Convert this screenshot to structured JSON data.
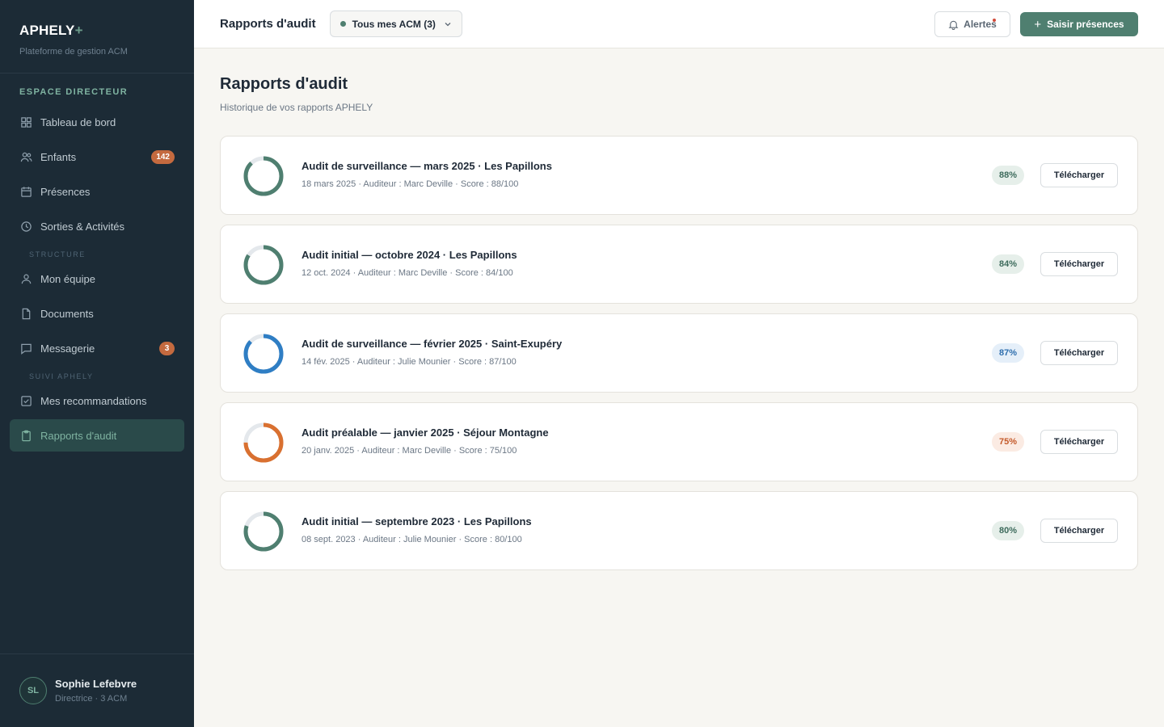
{
  "brand": {
    "name": "APHELY",
    "plus": "+",
    "subtitle": "Plateforme de gestion ACM"
  },
  "sidebar": {
    "section_main": "ESPACE DIRECTEUR",
    "items_main": [
      {
        "label": "Tableau de bord",
        "icon": "dashboard-icon"
      },
      {
        "label": "Enfants",
        "icon": "users-icon",
        "badge": "142"
      },
      {
        "label": "Présences",
        "icon": "calendar-icon"
      },
      {
        "label": "Sorties & Activités",
        "icon": "clock-icon"
      }
    ],
    "section_structure": "STRUCTURE",
    "items_structure": [
      {
        "label": "Mon équipe",
        "icon": "user-icon"
      },
      {
        "label": "Documents",
        "icon": "document-icon"
      },
      {
        "label": "Messagerie",
        "icon": "message-icon",
        "badge": "3"
      }
    ],
    "section_suivi": "SUIVI APHELY",
    "items_suivi": [
      {
        "label": "Mes recommandations",
        "icon": "checkbox-icon"
      },
      {
        "label": "Rapports d'audit",
        "icon": "clipboard-icon",
        "active": true
      }
    ]
  },
  "user": {
    "initials": "SL",
    "name": "Sophie Lefebvre",
    "role": "Directrice · 3 ACM"
  },
  "topbar": {
    "title": "Rapports d'audit",
    "acm_selector": "Tous mes ACM (3)",
    "alerts_label": "Alertes",
    "primary_label": "Saisir présences"
  },
  "page": {
    "title": "Rapports d'audit",
    "subtitle": "Historique de vos rapports APHELY"
  },
  "colors": {
    "green": "#4f7f70",
    "blue": "#2f7ec4",
    "orange": "#d97030",
    "track": "#e4e8ec"
  },
  "reports": [
    {
      "title": "Audit de surveillance — mars 2025 · Les Papillons",
      "meta": "18 mars 2025 · Auditeur : Marc Deville · Score : 88/100",
      "score": 88,
      "percent": "88%",
      "tone": "green",
      "download": "Télécharger"
    },
    {
      "title": "Audit initial — octobre 2024 · Les Papillons",
      "meta": "12 oct. 2024 · Auditeur : Marc Deville · Score : 84/100",
      "score": 84,
      "percent": "84%",
      "tone": "green",
      "download": "Télécharger"
    },
    {
      "title": "Audit de surveillance — février 2025 · Saint-Exupéry",
      "meta": "14 fév. 2025 · Auditeur : Julie Mounier · Score : 87/100",
      "score": 87,
      "percent": "87%",
      "tone": "blue",
      "download": "Télécharger"
    },
    {
      "title": "Audit préalable — janvier 2025 · Séjour Montagne",
      "meta": "20 janv. 2025 · Auditeur : Marc Deville · Score : 75/100",
      "score": 75,
      "percent": "75%",
      "tone": "orange",
      "download": "Télécharger"
    },
    {
      "title": "Audit initial — septembre 2023 · Les Papillons",
      "meta": "08 sept. 2023 · Auditeur : Julie Mounier · Score : 80/100",
      "score": 80,
      "percent": "80%",
      "tone": "green",
      "download": "Télécharger"
    }
  ]
}
